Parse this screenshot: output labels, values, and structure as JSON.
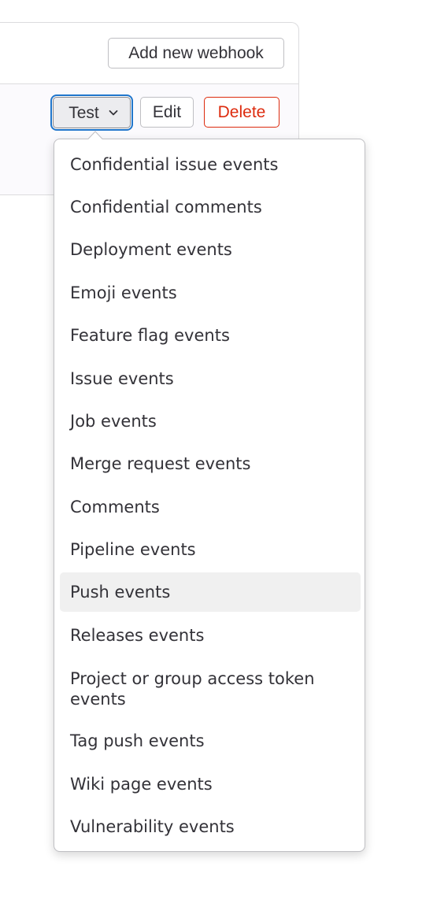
{
  "header": {
    "add_webhook_label": "Add new webhook"
  },
  "hook_actions": {
    "test_label": "Test",
    "edit_label": "Edit",
    "delete_label": "Delete",
    "delete_color": "#dd2b0e",
    "test_focus_color": "#1f75cb"
  },
  "test_menu": {
    "highlighted_item": "Push events",
    "items": [
      {
        "label": "Confidential issue events"
      },
      {
        "label": "Confidential comments"
      },
      {
        "label": "Deployment events"
      },
      {
        "label": "Emoji events"
      },
      {
        "label": "Feature flag events"
      },
      {
        "label": "Issue events"
      },
      {
        "label": "Job events"
      },
      {
        "label": "Merge request events"
      },
      {
        "label": "Comments"
      },
      {
        "label": "Pipeline events"
      },
      {
        "label": "Push events"
      },
      {
        "label": "Releases events"
      },
      {
        "label": "Project or group access token events"
      },
      {
        "label": "Tag push events"
      },
      {
        "label": "Wiki page events"
      },
      {
        "label": "Vulnerability events"
      }
    ]
  },
  "icons": {
    "test_dropdown": "chevron-down-icon"
  }
}
